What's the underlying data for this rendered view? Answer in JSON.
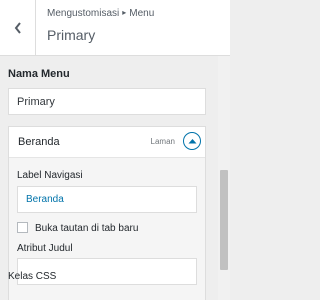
{
  "header": {
    "breadcrumb_parent": "Mengustomisasi",
    "breadcrumb_separator": "▸",
    "breadcrumb_current": "Menu",
    "title": "Primary"
  },
  "menu_name": {
    "label": "Nama Menu",
    "value": "Primary"
  },
  "menu_item": {
    "title": "Beranda",
    "type": "Laman",
    "nav_label_caption": "Label Navigasi",
    "nav_label_placeholder": "Beranda",
    "new_tab_label": "Buka tautan di tab baru",
    "new_tab_checked": false,
    "title_attr_caption": "Atribut Judul",
    "title_attr_value": "",
    "css_caption": "Kelas CSS"
  },
  "colors": {
    "accent": "#0073aa",
    "panel_bg": "#eeeeee",
    "border": "#dddddd"
  }
}
